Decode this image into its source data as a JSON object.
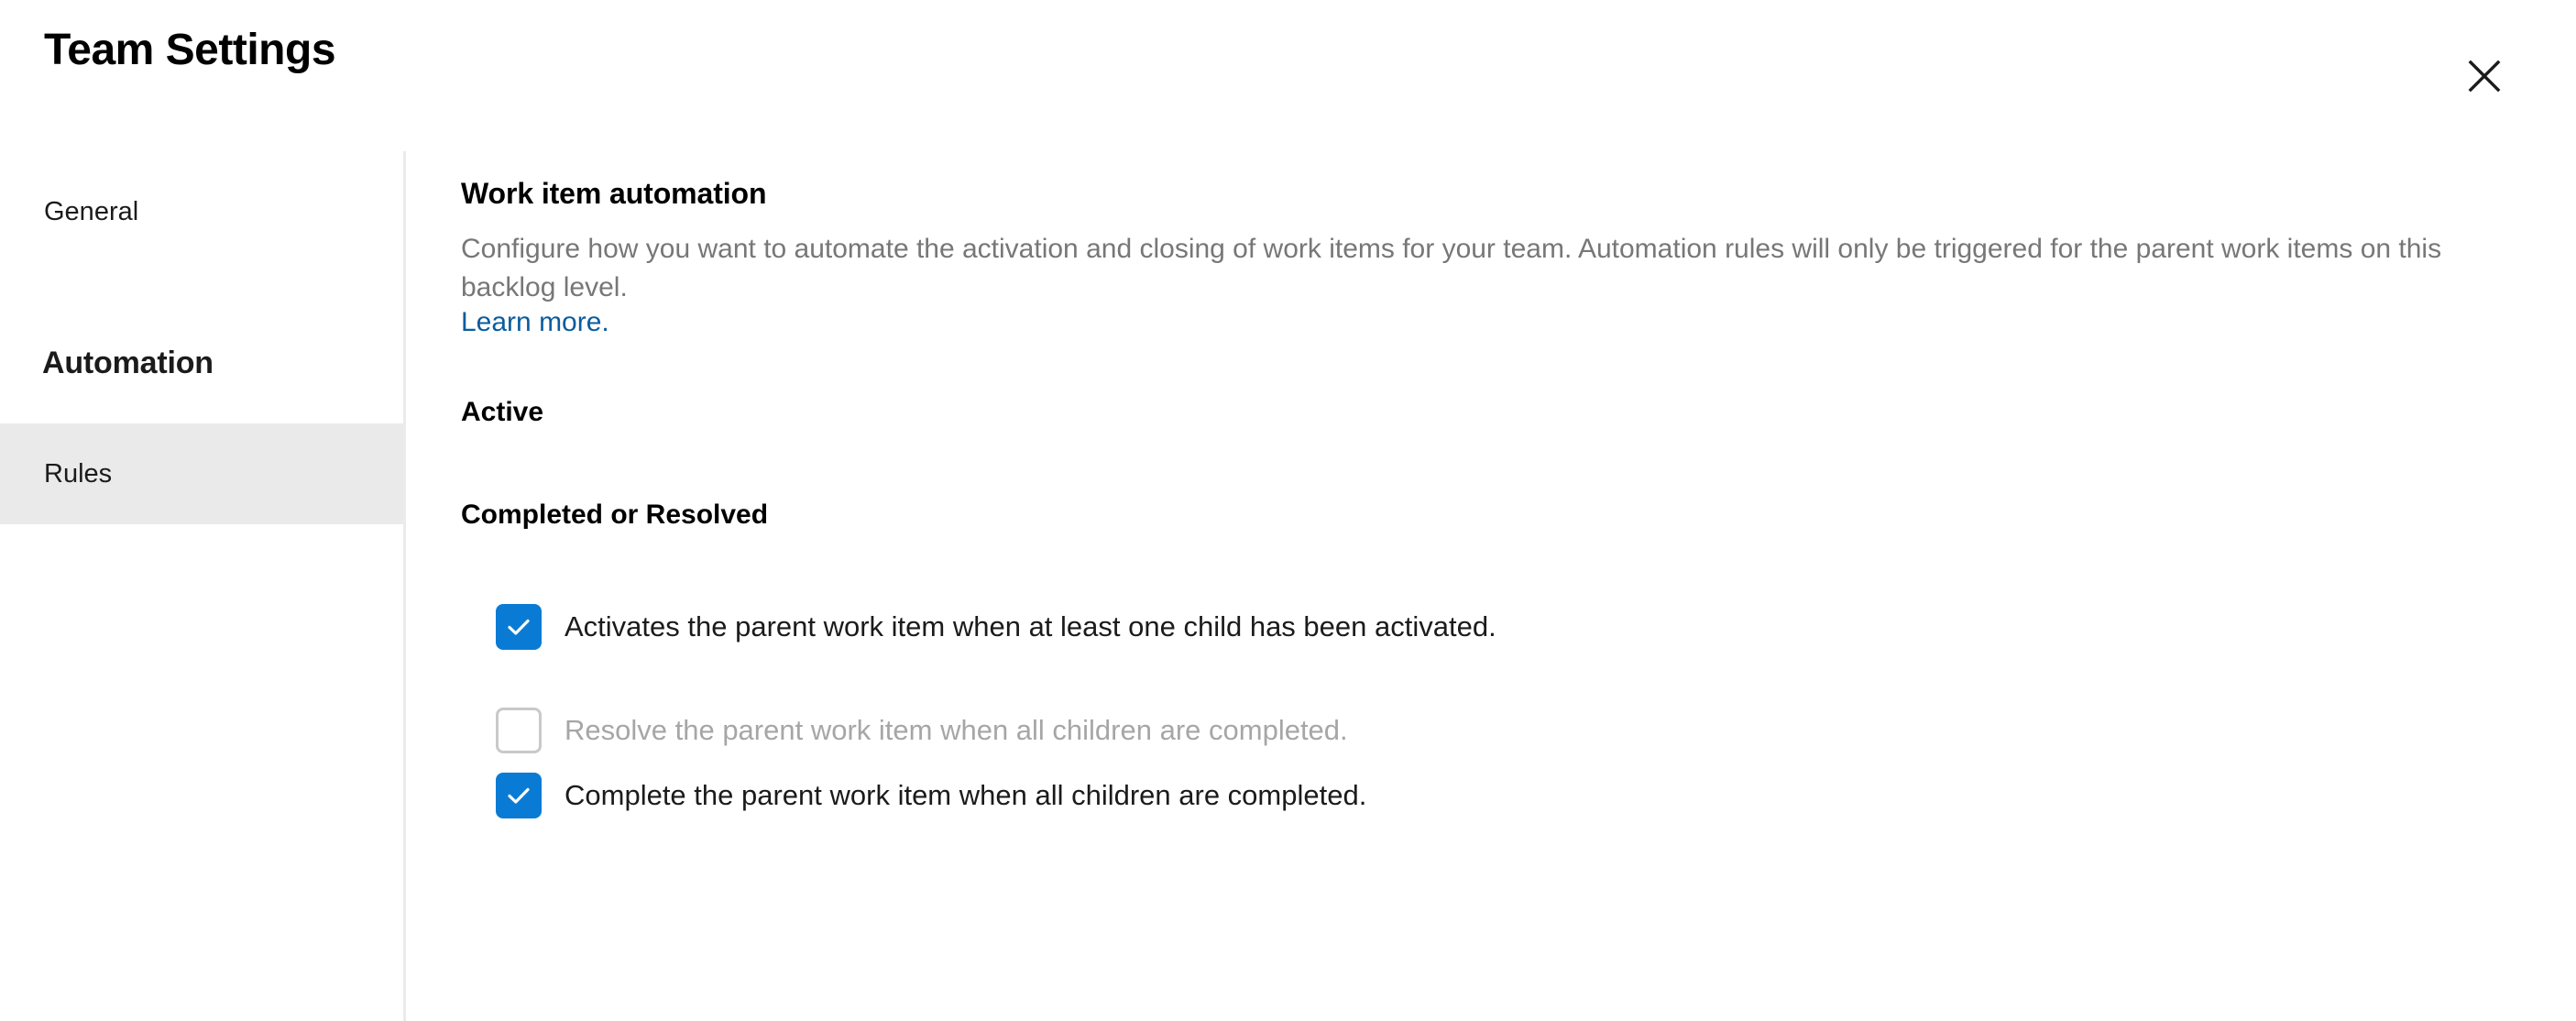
{
  "header": {
    "title": "Team Settings",
    "close_icon": "close-icon"
  },
  "sidebar": {
    "items": [
      {
        "label": "General",
        "selected": false,
        "type": "item"
      },
      {
        "label": "Automation",
        "selected": false,
        "type": "group-heading"
      },
      {
        "label": "Rules",
        "selected": true,
        "type": "item"
      }
    ]
  },
  "main": {
    "heading": "Work item automation",
    "description": "Configure how you want to automate the activation and closing of work items for your team. Automation rules will only be triggered for the parent work items on this backlog level.",
    "learn_more": "Learn more.",
    "groups": [
      {
        "heading": "Active",
        "rules": [
          {
            "label": "Activates the parent work item when at least one child has been activated.",
            "checked": true,
            "disabled": false
          }
        ]
      },
      {
        "heading": "Completed or Resolved",
        "rules": [
          {
            "label": "Resolve the parent work item when all children are completed.",
            "checked": false,
            "disabled": true
          },
          {
            "label": "Complete the parent work item when all children are completed.",
            "checked": true,
            "disabled": false
          }
        ]
      }
    ]
  },
  "colors": {
    "accent": "#0a7bd4",
    "link": "#0a5c9e",
    "selected_nav_bg": "#eaeaea",
    "muted_text": "#777777",
    "disabled_text": "#a6a6a6",
    "divider": "#ebebeb"
  }
}
